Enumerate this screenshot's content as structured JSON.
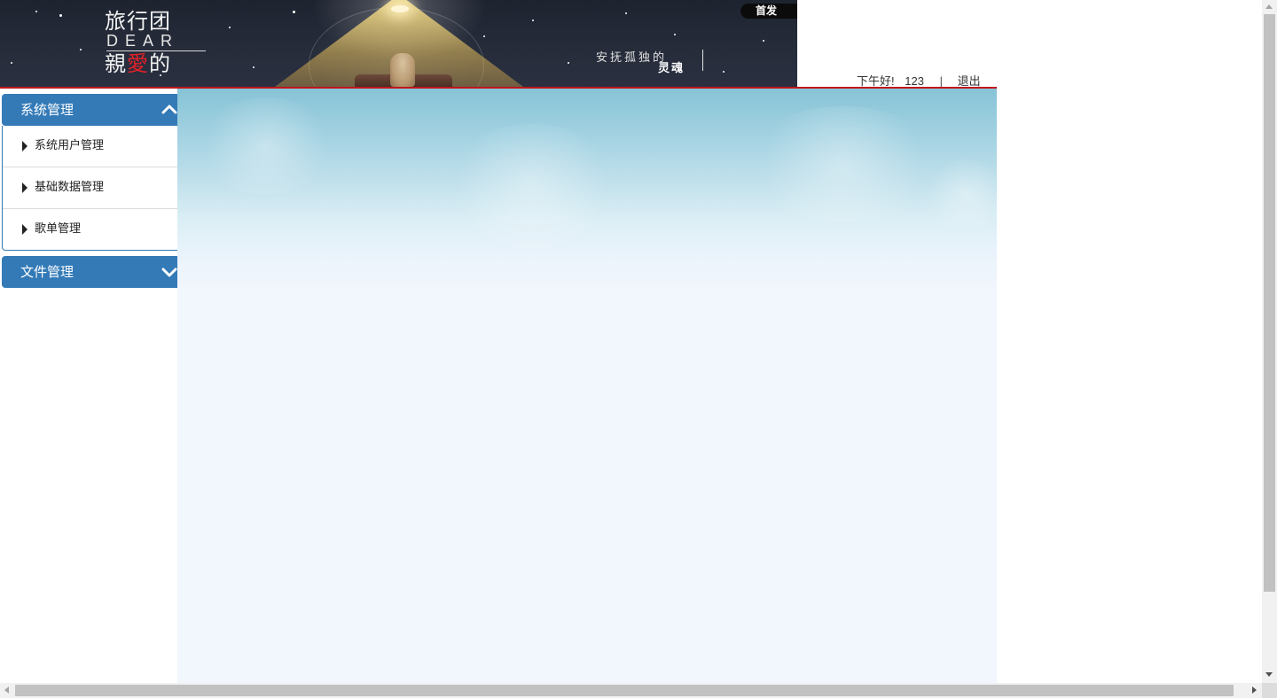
{
  "banner": {
    "title_line1": "旅行团",
    "title_line2": "DEAR",
    "title_line3_part1": "親",
    "title_line3_red": "愛",
    "title_line3_part2": "的",
    "slogan_line1": "安抚孤独的",
    "slogan_line2": "灵魂",
    "badge": "首发"
  },
  "topbar": {
    "greeting": "下午好!",
    "username": "123",
    "separator": "|",
    "logout_label": "退出"
  },
  "sidebar": {
    "panels": [
      {
        "title": "系统管理",
        "expanded": true,
        "items": [
          {
            "label": "系统用户管理"
          },
          {
            "label": "基础数据管理"
          },
          {
            "label": "歌单管理"
          }
        ]
      },
      {
        "title": "文件管理",
        "expanded": false,
        "items": []
      }
    ]
  },
  "colors": {
    "panel_heading": "#337ab7",
    "accent_line": "#c0141c",
    "content_bg": "#f2f6fd"
  },
  "icons": {
    "expanded": "chevron-up-icon",
    "collapsed": "chevron-down-icon",
    "menu_item": "caret-right-icon"
  }
}
